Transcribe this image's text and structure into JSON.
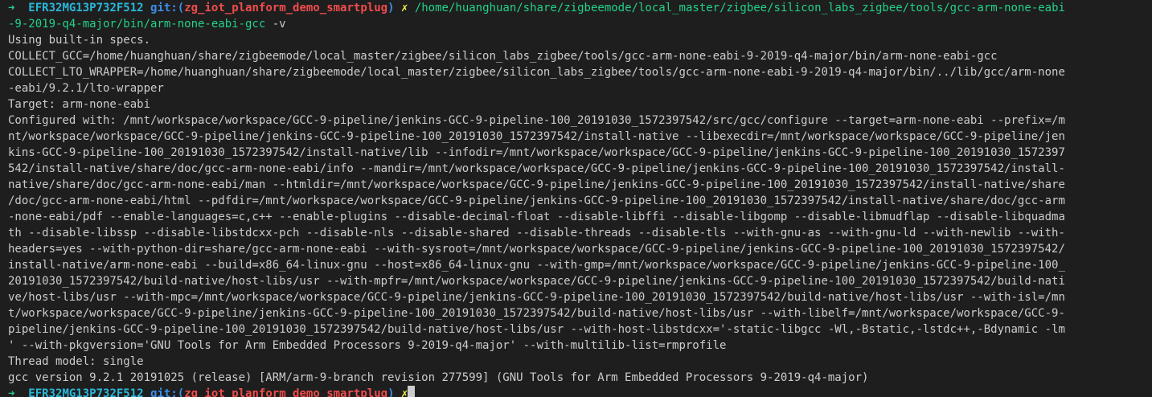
{
  "prompt": {
    "arrow": "➜",
    "host": "EFR32MG13P732F512",
    "git_label": "git:(",
    "branch": "zg_iot_planform_demo_smartplug",
    "git_close": ")",
    "dirty_mark": "✗",
    "cmd_path_1": "/home/huanghuan/share/zigbeemode/local_master/zigbee/silicon_labs_zigbee/tools/gcc-arm-none-eabi",
    "cmd_path_2": "-9-2019-q4-major/bin/arm-none-eabi-gcc",
    "cmd_args": " -v"
  },
  "output": [
    "Using built-in specs.",
    "COLLECT_GCC=/home/huanghuan/share/zigbeemode/local_master/zigbee/silicon_labs_zigbee/tools/gcc-arm-none-eabi-9-2019-q4-major/bin/arm-none-eabi-gcc",
    "COLLECT_LTO_WRAPPER=/home/huanghuan/share/zigbeemode/local_master/zigbee/silicon_labs_zigbee/tools/gcc-arm-none-eabi-9-2019-q4-major/bin/../lib/gcc/arm-none",
    "-eabi/9.2.1/lto-wrapper",
    "Target: arm-none-eabi",
    "Configured with: /mnt/workspace/workspace/GCC-9-pipeline/jenkins-GCC-9-pipeline-100_20191030_1572397542/src/gcc/configure --target=arm-none-eabi --prefix=/m",
    "nt/workspace/workspace/GCC-9-pipeline/jenkins-GCC-9-pipeline-100_20191030_1572397542/install-native --libexecdir=/mnt/workspace/workspace/GCC-9-pipeline/jen",
    "kins-GCC-9-pipeline-100_20191030_1572397542/install-native/lib --infodir=/mnt/workspace/workspace/GCC-9-pipeline/jenkins-GCC-9-pipeline-100_20191030_1572397",
    "542/install-native/share/doc/gcc-arm-none-eabi/info --mandir=/mnt/workspace/workspace/GCC-9-pipeline/jenkins-GCC-9-pipeline-100_20191030_1572397542/install-",
    "native/share/doc/gcc-arm-none-eabi/man --htmldir=/mnt/workspace/workspace/GCC-9-pipeline/jenkins-GCC-9-pipeline-100_20191030_1572397542/install-native/share",
    "/doc/gcc-arm-none-eabi/html --pdfdir=/mnt/workspace/workspace/GCC-9-pipeline/jenkins-GCC-9-pipeline-100_20191030_1572397542/install-native/share/doc/gcc-arm",
    "-none-eabi/pdf --enable-languages=c,c++ --enable-plugins --disable-decimal-float --disable-libffi --disable-libgomp --disable-libmudflap --disable-libquadma",
    "th --disable-libssp --disable-libstdcxx-pch --disable-nls --disable-shared --disable-threads --disable-tls --with-gnu-as --with-gnu-ld --with-newlib --with-",
    "headers=yes --with-python-dir=share/gcc-arm-none-eabi --with-sysroot=/mnt/workspace/workspace/GCC-9-pipeline/jenkins-GCC-9-pipeline-100_20191030_1572397542/",
    "install-native/arm-none-eabi --build=x86_64-linux-gnu --host=x86_64-linux-gnu --with-gmp=/mnt/workspace/workspace/GCC-9-pipeline/jenkins-GCC-9-pipeline-100_",
    "20191030_1572397542/build-native/host-libs/usr --with-mpfr=/mnt/workspace/workspace/GCC-9-pipeline/jenkins-GCC-9-pipeline-100_20191030_1572397542/build-nati",
    "ve/host-libs/usr --with-mpc=/mnt/workspace/workspace/GCC-9-pipeline/jenkins-GCC-9-pipeline-100_20191030_1572397542/build-native/host-libs/usr --with-isl=/mn",
    "t/workspace/workspace/GCC-9-pipeline/jenkins-GCC-9-pipeline-100_20191030_1572397542/build-native/host-libs/usr --with-libelf=/mnt/workspace/workspace/GCC-9-",
    "pipeline/jenkins-GCC-9-pipeline-100_20191030_1572397542/build-native/host-libs/usr --with-host-libstdcxx='-static-libgcc -Wl,-Bstatic,-lstdc++,-Bdynamic -lm",
    "' --with-pkgversion='GNU Tools for Arm Embedded Processors 9-2019-q4-major' --with-multilib-list=rmprofile",
    "Thread model: single",
    "gcc version 9.2.1 20191025 (release) [ARM/arm-9-branch revision 277599] (GNU Tools for Arm Embedded Processors 9-2019-q4-major)"
  ],
  "next_prompt": {
    "arrow": "➜",
    "host": "EFR32MG13P732F512",
    "git_label": "git:(",
    "branch": "zg_iot_planform_demo_smartplug",
    "git_close": ")",
    "dirty_mark": "✗"
  },
  "colors": {
    "background": "#1e1e1e",
    "text": "#cccccc",
    "arrow": "#23d18b",
    "host": "#29b8db",
    "git": "#3b8eea",
    "branch": "#f14c4c",
    "dirty": "#f5f543",
    "command": "#23d18b"
  }
}
